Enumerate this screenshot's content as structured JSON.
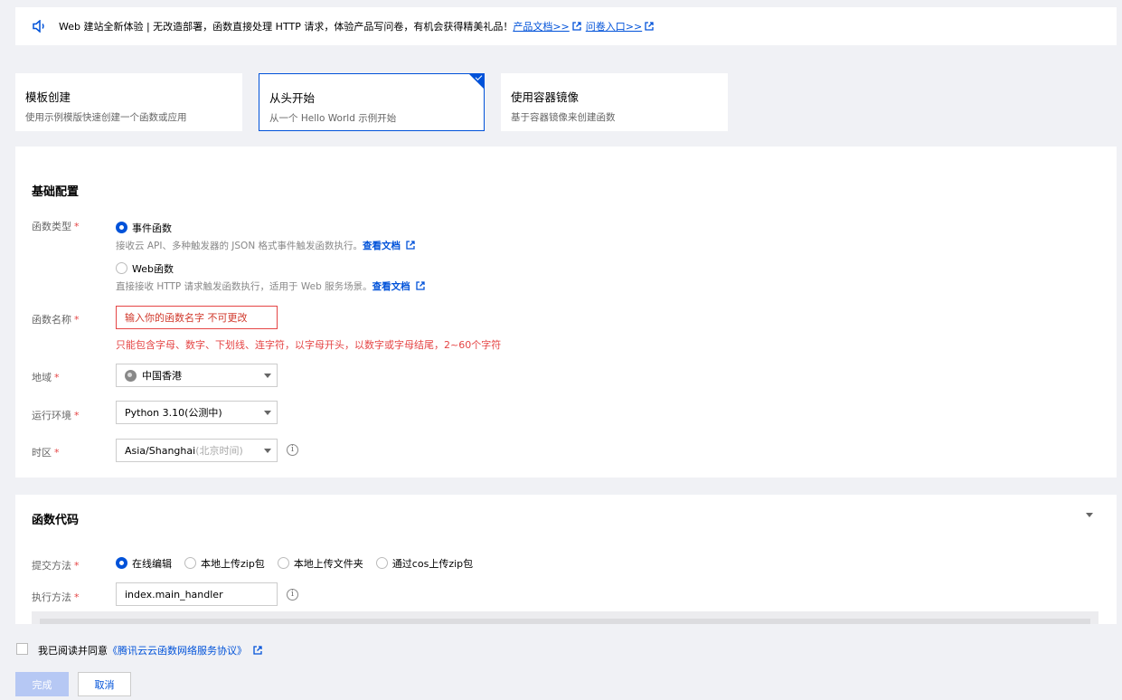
{
  "notice": {
    "text": "Web 建站全新体验 | 无改造部署，函数直接处理 HTTP 请求，体验产品写问卷，有机会获得精美礼品！",
    "link1": "产品文档>>",
    "link2": "问卷入口>>"
  },
  "templates": [
    {
      "title": "模板创建",
      "desc": "使用示例模版快速创建一个函数或应用"
    },
    {
      "title": "从头开始",
      "desc": "从一个 Hello World 示例开始"
    },
    {
      "title": "使用容器镜像",
      "desc": "基于容器镜像来创建函数"
    }
  ],
  "basic": {
    "title": "基础配置",
    "type_label": "函数类型",
    "type_options": [
      {
        "label": "事件函数",
        "hint": "接收云 API、多种触发器的 JSON 格式事件触发函数执行。",
        "link": "查看文档",
        "selected": true
      },
      {
        "label": "Web函数",
        "hint": "直接接收 HTTP 请求触发函数执行，适用于 Web 服务场景。",
        "link": "查看文档",
        "selected": false
      }
    ],
    "name_label": "函数名称",
    "name_value": "输入你的函数名字 不可更改",
    "name_error": "只能包含字母、数字、下划线、连字符，以字母开头，以数字或字母结尾，2~60个字符",
    "region_label": "地域",
    "region_value": "中国香港",
    "runtime_label": "运行环境",
    "runtime_value": "Python 3.10(公测中)",
    "tz_label": "时区",
    "tz_value": "Asia/Shanghai",
    "tz_hint": "(北京时间)"
  },
  "code": {
    "title": "函数代码",
    "submit_label": "提交方法",
    "submit_options": [
      "在线编辑",
      "本地上传zip包",
      "本地上传文件夹",
      "通过cos上传zip包"
    ],
    "handler_label": "执行方法",
    "handler_value": "index.main_handler"
  },
  "agreement": {
    "prefix": "我已阅读并同意",
    "link": "《腾讯云云函数网络服务协议》"
  },
  "buttons": {
    "finish": "完成",
    "cancel": "取消"
  },
  "colors": {
    "accent": "#0052d9",
    "error": "#e54545"
  }
}
